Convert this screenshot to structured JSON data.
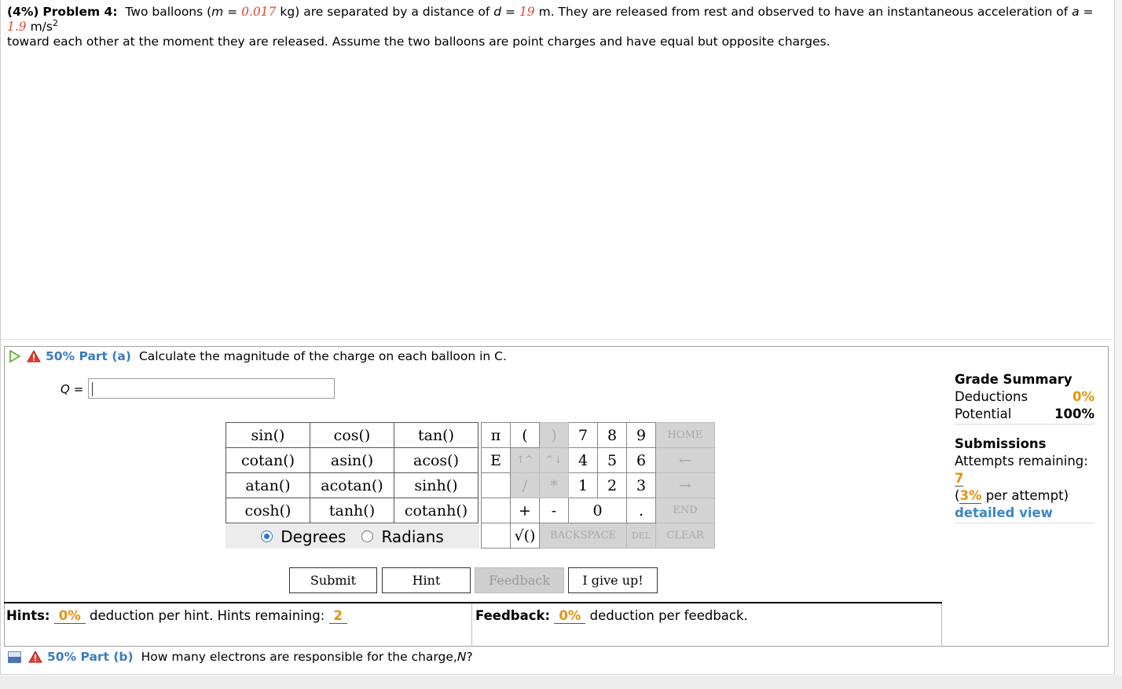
{
  "problem": {
    "weight": "(4%)",
    "label": "Problem 4:",
    "text1": "Two balloons (",
    "m_var": "m",
    "eq1": " = ",
    "m_val": "0.017",
    "text2": " kg) are separated by a distance of ",
    "d_var": "d",
    "eq2": " = ",
    "d_val": "19",
    "text3": " m. They are released from rest and observed to have an instantaneous acceleration of ",
    "a_var": "a",
    "eq3": " = ",
    "a_val": "1.9",
    "unit_a": " m/s",
    "unit_exp": "2",
    "text4": "toward each other at the moment they are released. Assume the two balloons are point charges and have equal but opposite charges."
  },
  "part_a": {
    "pct": "50% Part (a)",
    "text": "Calculate the magnitude of the charge on each balloon in C.",
    "answer_label_var": "Q",
    "answer_label_eq": " = ",
    "answer_value": ""
  },
  "function_keys": [
    [
      "sin()",
      "cos()",
      "tan()"
    ],
    [
      "cotan()",
      "asin()",
      "acos()"
    ],
    [
      "atan()",
      "acotan()",
      "sinh()"
    ],
    [
      "cosh()",
      "tanh()",
      "cotanh()"
    ]
  ],
  "angle_mode": {
    "degrees": "Degrees",
    "radians": "Radians",
    "selected": "Degrees"
  },
  "keypad": {
    "pi": "π",
    "lparen": "(",
    "rparen": ")",
    "k7": "7",
    "k8": "8",
    "k9": "9",
    "home": "HOME",
    "e": "E",
    "up": "↑^",
    "down": "^↓",
    "k4": "4",
    "k5": "5",
    "k6": "6",
    "left": "←",
    "div": "/",
    "mul": "*",
    "k1": "1",
    "k2": "2",
    "k3": "3",
    "right": "→",
    "plus": "+",
    "minus": "-",
    "k0": "0",
    "dot": ".",
    "end": "END",
    "sqrt": "√()",
    "backspace": "BACKSPACE",
    "del": "DEL",
    "clear": "CLEAR"
  },
  "buttons": {
    "submit": "Submit",
    "hint": "Hint",
    "feedback": "Feedback",
    "give_up": "I give up!"
  },
  "hints": {
    "label": "Hints:",
    "deduction": "0%",
    "text": " deduction per hint. Hints remaining: ",
    "remaining": "2"
  },
  "feedback": {
    "label": "Feedback:",
    "deduction": "0%",
    "text": " deduction per feedback."
  },
  "grade_summary": {
    "title": "Grade Summary",
    "deductions_label": "Deductions",
    "deductions_value": "0%",
    "potential_label": "Potential",
    "potential_value": "100%",
    "submissions_title": "Submissions",
    "attempts_label": "Attempts remaining: ",
    "attempts_value": "7",
    "per_attempt_open": "(",
    "per_attempt_value": "3%",
    "per_attempt_text": " per attempt)",
    "detailed_view": "detailed view"
  },
  "part_b": {
    "pct": "50% Part (b)",
    "text": "How many electrons are responsible for the charge, ",
    "var": "N",
    "end": "?"
  },
  "colors": {
    "accent_orange": "#e8920f",
    "value_red": "#e0472f",
    "link_blue": "#3a87c6"
  }
}
